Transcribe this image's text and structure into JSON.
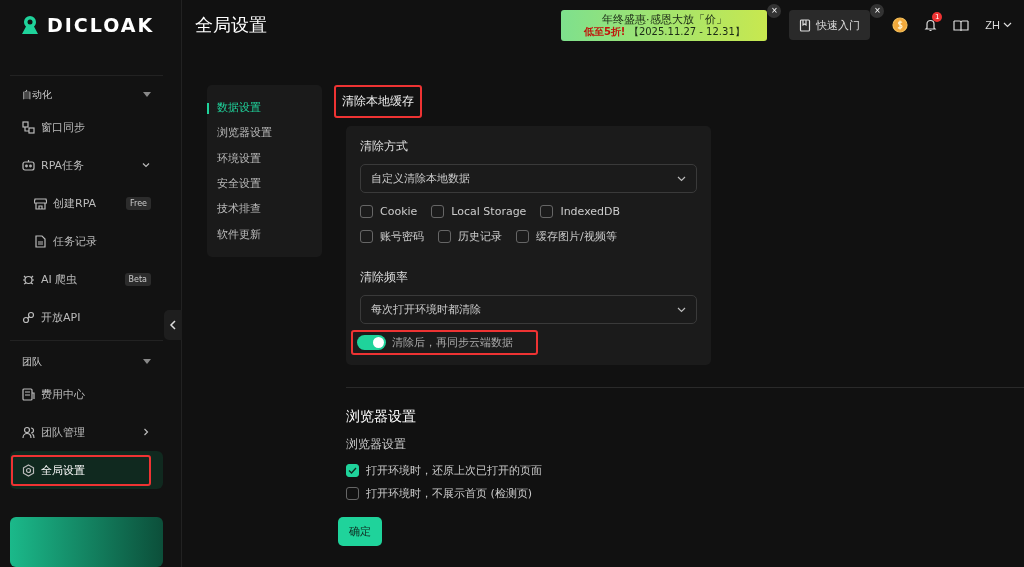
{
  "logo": {
    "text": "DICLOAK"
  },
  "sidebar": {
    "sections": [
      {
        "title": "自动化",
        "expanded": true,
        "items": [
          {
            "label": "窗口同步",
            "selected": false,
            "annotated": false
          },
          {
            "label": "RPA任务",
            "selected": false,
            "annotated": false,
            "expanded": true,
            "children": [
              {
                "label": "创建RPA",
                "badge": "Free",
                "selected": false
              },
              {
                "label": "任务记录",
                "selected": false
              }
            ]
          },
          {
            "label": "AI 爬虫",
            "badge": "Beta",
            "selected": false,
            "annotated": false
          },
          {
            "label": "开放API",
            "selected": false,
            "annotated": false
          }
        ]
      },
      {
        "title": "团队",
        "expanded": true,
        "items": [
          {
            "label": "费用中心",
            "selected": false,
            "annotated": false
          },
          {
            "label": "团队管理",
            "selected": false,
            "annotated": false,
            "expanded": false
          },
          {
            "label": "全局设置",
            "selected": true,
            "annotated": true
          }
        ]
      }
    ]
  },
  "header": {
    "title": "全局设置",
    "promo": {
      "title": "年终盛惠·感恩大放「价」",
      "discount": "低至5折!",
      "dates": "【2025.11.27 - 12.31】",
      "close": "×"
    },
    "quick_start": {
      "label": "快速入门",
      "close": "×"
    },
    "notifications": {
      "count": "1"
    },
    "language": "ZH"
  },
  "settings_nav": [
    {
      "label": "数据设置",
      "selected": true
    },
    {
      "label": "浏览器设置",
      "selected": false
    },
    {
      "label": "环境设置",
      "selected": false
    },
    {
      "label": "安全设置",
      "selected": false
    },
    {
      "label": "技术排查",
      "selected": false
    },
    {
      "label": "软件更新",
      "selected": false
    }
  ],
  "clear_cache": {
    "title": "清除本地缓存",
    "annotated": true,
    "method_label": "清除方式",
    "method_value": "自定义清除本地数据",
    "options": [
      [
        {
          "label": "Cookie",
          "checked": false
        },
        {
          "label": "Local Storage",
          "checked": false
        },
        {
          "label": "IndexedDB",
          "checked": false
        }
      ],
      [
        {
          "label": "账号密码",
          "checked": false
        },
        {
          "label": "历史记录",
          "checked": false
        },
        {
          "label": "缓存图片/视频等",
          "checked": false
        }
      ]
    ],
    "frequency_label": "清除频率",
    "frequency_value": "每次打开环境时都清除",
    "sync_toggle": {
      "label": "清除后，再同步云端数据",
      "on": true,
      "annotated": true
    }
  },
  "browser_settings": {
    "title": "浏览器设置",
    "subtitle": "浏览器设置",
    "options": [
      {
        "label": "打开环境时，还原上次已打开的页面",
        "checked": true
      },
      {
        "label": "打开环境时，不展示首页 (检测页)",
        "checked": false
      }
    ]
  },
  "confirm_button": "确定"
}
